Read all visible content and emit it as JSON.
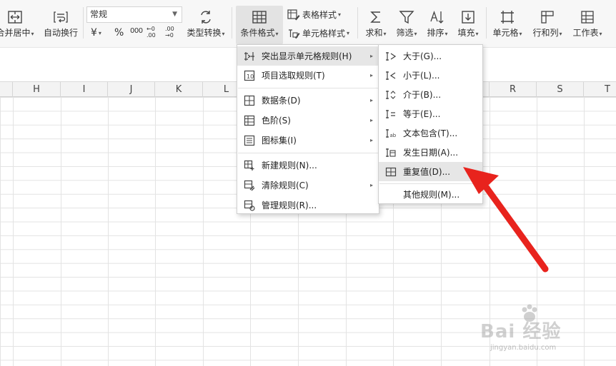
{
  "ribbon": {
    "merge_label": "合并居中",
    "wrap_label": "自动换行",
    "number_format": "常规",
    "currency_symbol": "¥",
    "percent_symbol": "%",
    "thousands_symbol": "000",
    "inc_decimal": "←0 .00",
    "dec_decimal": ".00 →0",
    "convert_label": "类型转换",
    "cond_format_label": "条件格式",
    "table_style_label": "表格样式",
    "cell_style_label": "单元格样式",
    "sum_label": "求和",
    "filter_label": "筛选",
    "sort_label": "排序",
    "fill_label": "填充",
    "cell_label": "单元格",
    "rowcol_label": "行和列",
    "sheet_label": "工作表"
  },
  "columns": [
    "H",
    "I",
    "J",
    "K",
    "L",
    "R",
    "S",
    "T"
  ],
  "cond_menu": {
    "items": [
      {
        "label": "突出显示单元格规则(H)",
        "icon": "highlight-rules-icon",
        "submenu": true
      },
      {
        "label": "项目选取规则(T)",
        "icon": "top-bottom-rules-icon",
        "submenu": true
      },
      {
        "label": "数据条(D)",
        "icon": "data-bars-icon",
        "submenu": true
      },
      {
        "label": "色阶(S)",
        "icon": "color-scale-icon",
        "submenu": true
      },
      {
        "label": "图标集(I)",
        "icon": "icon-sets-icon",
        "submenu": true
      },
      {
        "label": "新建规则(N)...",
        "icon": "new-rule-icon",
        "submenu": false
      },
      {
        "label": "清除规则(C)",
        "icon": "clear-rules-icon",
        "submenu": true
      },
      {
        "label": "管理规则(R)...",
        "icon": "manage-rules-icon",
        "submenu": false
      }
    ]
  },
  "highlight_menu": {
    "items": [
      {
        "label": "大于(G)...",
        "icon": "greater-than-icon"
      },
      {
        "label": "小于(L)...",
        "icon": "less-than-icon"
      },
      {
        "label": "介于(B)...",
        "icon": "between-icon"
      },
      {
        "label": "等于(E)...",
        "icon": "equal-to-icon"
      },
      {
        "label": "文本包含(T)...",
        "icon": "text-contains-icon"
      },
      {
        "label": "发生日期(A)...",
        "icon": "date-occurring-icon"
      },
      {
        "label": "重复值(D)...",
        "icon": "duplicate-values-icon"
      },
      {
        "label": "其他规则(M)...",
        "icon": ""
      }
    ]
  },
  "annotation": {
    "color": "#e8231d"
  },
  "watermark": {
    "brand": "Bai 经验",
    "url": "jingyan.baidu.com"
  }
}
